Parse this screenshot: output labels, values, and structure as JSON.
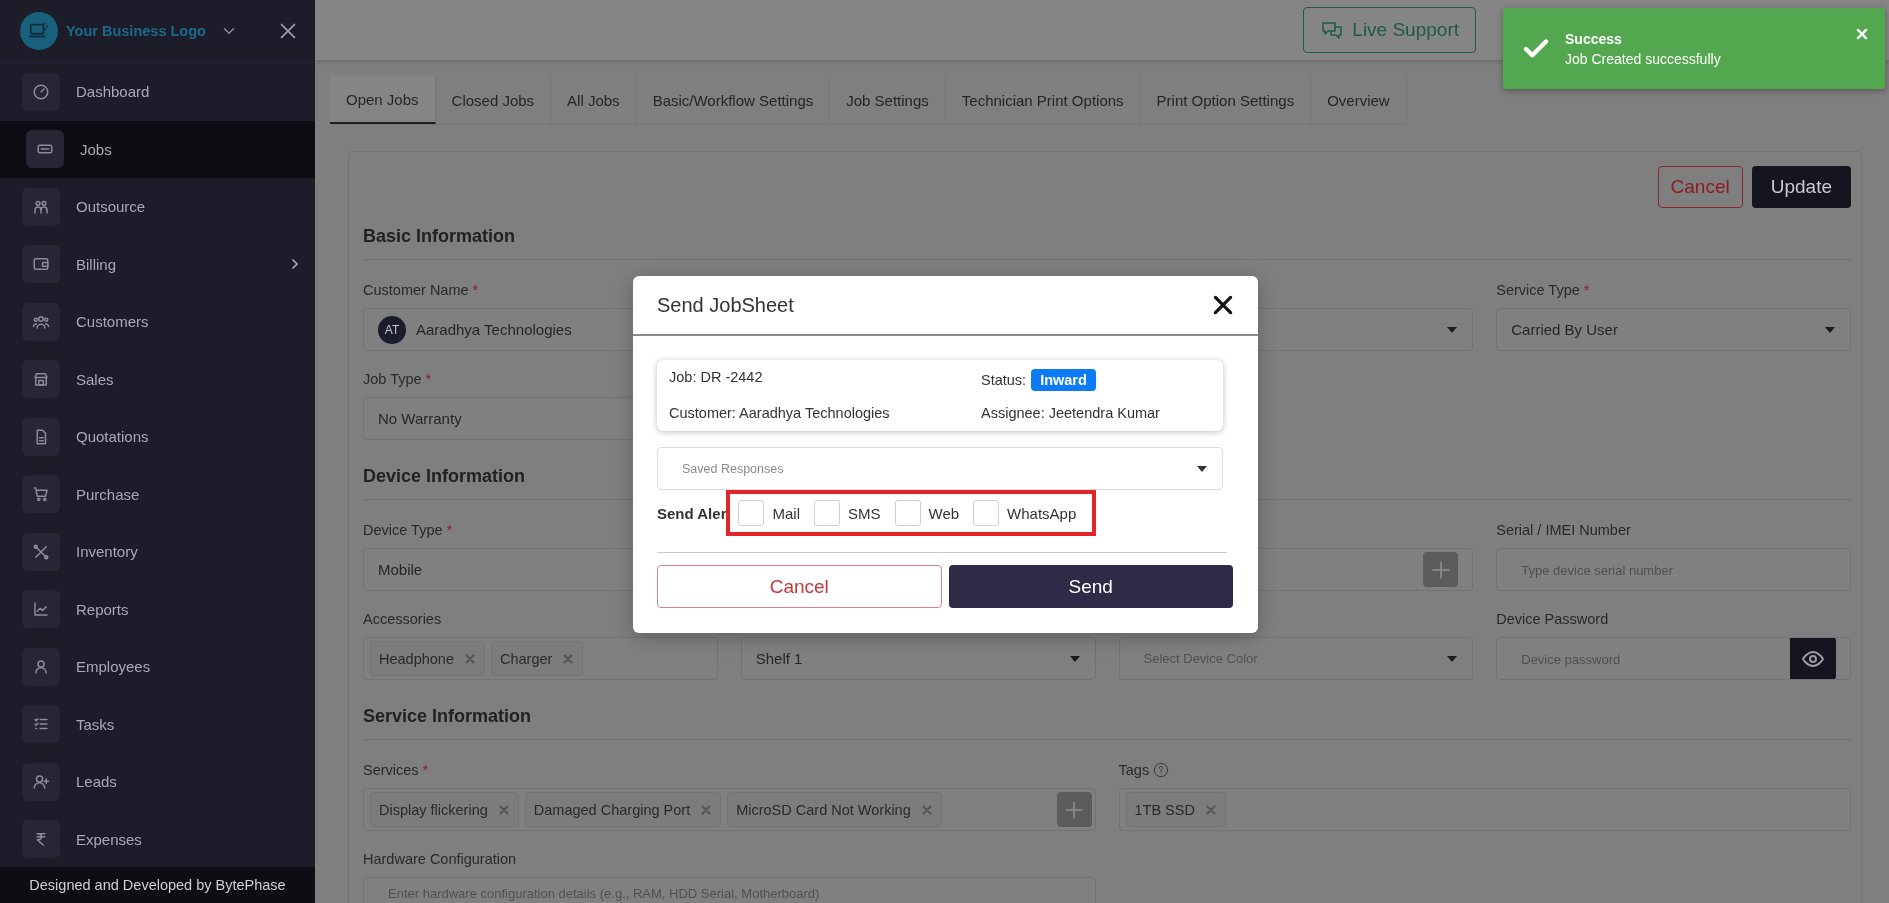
{
  "sidebar": {
    "logo_text": "Your Business Logo",
    "items": [
      {
        "label": "Dashboard",
        "selected": false
      },
      {
        "label": "Jobs",
        "selected": true
      },
      {
        "label": "Outsource",
        "selected": false
      },
      {
        "label": "Billing",
        "selected": false,
        "submenu": true
      },
      {
        "label": "Customers",
        "selected": false
      },
      {
        "label": "Sales",
        "selected": false
      },
      {
        "label": "Quotations",
        "selected": false
      },
      {
        "label": "Purchase",
        "selected": false
      },
      {
        "label": "Inventory",
        "selected": false
      },
      {
        "label": "Reports",
        "selected": false
      },
      {
        "label": "Employees",
        "selected": false
      },
      {
        "label": "Tasks",
        "selected": false
      },
      {
        "label": "Leads",
        "selected": false
      },
      {
        "label": "Expenses",
        "selected": false
      }
    ],
    "footer": "Designed and Developed by BytePhase"
  },
  "topbar": {
    "live_support": "Live Support"
  },
  "tabs": [
    {
      "label": "Open Jobs",
      "selected": true
    },
    {
      "label": "Closed Jobs",
      "selected": false
    },
    {
      "label": "All Jobs",
      "selected": false
    },
    {
      "label": "Basic/Workflow Settings",
      "selected": false
    },
    {
      "label": "Job Settings",
      "selected": false
    },
    {
      "label": "Technician Print Options",
      "selected": false
    },
    {
      "label": "Print Option Settings",
      "selected": false
    },
    {
      "label": "Overview",
      "selected": false
    }
  ],
  "form": {
    "cancel": "Cancel",
    "update": "Update",
    "sections": [
      {
        "title": "Basic Information",
        "rows": [
          [
            {
              "kind": "customer",
              "label": "Customer Name",
              "required_mark": "*",
              "initials": "AT",
              "value": "Aaradhya Technologies"
            },
            null,
            {
              "kind": "select"
            },
            {
              "kind": "select",
              "label": "Service Type",
              "required_mark": "*",
              "value": "Carried By User"
            }
          ],
          [
            {
              "kind": "text",
              "label": "Job Type",
              "required_mark": "*",
              "value": "No Warranty"
            },
            null,
            null,
            null
          ]
        ]
      },
      {
        "title": "Device Information",
        "rows": [
          [
            {
              "kind": "text",
              "label": "Device Type",
              "required_mark": "*",
              "value": "Mobile"
            },
            null,
            {
              "kind": "add"
            },
            {
              "kind": "text",
              "label": "Serial / IMEI Number",
              "placeholder": "Type device serial number"
            }
          ],
          [
            {
              "kind": "tags",
              "label": "Accessories",
              "tags": [
                "Headphone",
                "Charger"
              ]
            },
            {
              "kind": "select",
              "value": "Shelf 1"
            },
            {
              "kind": "select",
              "placeholder": "Select Device Color"
            },
            {
              "kind": "password",
              "label": "Device Password",
              "placeholder": "Device password"
            }
          ]
        ]
      },
      {
        "title": "Service Information",
        "rows": [
          [
            {
              "kind": "tags",
              "label": "Services",
              "required_mark": "*",
              "tags": [
                "Display flickering",
                "Damaged Charging Port",
                "MicroSD Card Not Working"
              ],
              "add_button": true
            },
            {
              "kind": "tags",
              "label": "Tags",
              "help_icon": true,
              "tags": [
                "1TB SSD"
              ]
            }
          ],
          [
            {
              "kind": "textarea",
              "label": "Hardware Configuration",
              "placeholder": "Enter hardware configuration details (e.g., RAM, HDD Serial, Motherboard)"
            },
            null
          ]
        ]
      }
    ]
  },
  "modal": {
    "title": "Send JobSheet",
    "job": "Job: DR -2442",
    "status_label": "Status:",
    "status": "Inward",
    "customer": "Customer: Aaradhya Technologies",
    "assignee": "Assignee: Jeetendra Kumar",
    "saved_responses_placeholder": "Saved Responses",
    "alert_label": "Send Aler",
    "alerts_highlighted": true,
    "channels": [
      {
        "label": "Mail",
        "checked": false
      },
      {
        "label": "SMS",
        "checked": false
      },
      {
        "label": "Web",
        "checked": false
      },
      {
        "label": "WhatsApp",
        "checked": false
      }
    ],
    "cancel": "Cancel",
    "send": "Send"
  },
  "toast": {
    "title": "Success",
    "message": "Job Created successfully"
  }
}
